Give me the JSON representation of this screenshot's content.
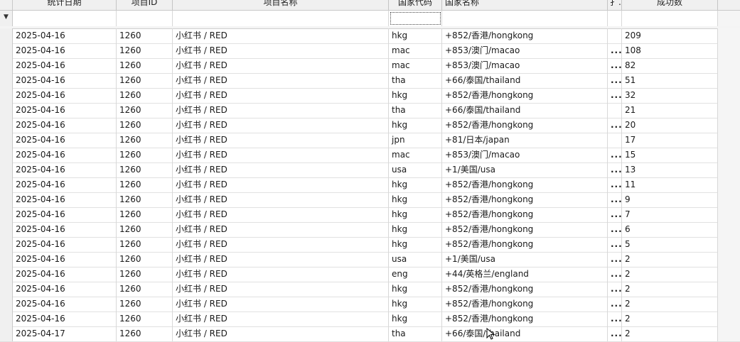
{
  "grid": {
    "columns": [
      "统计日期",
      "项目ID",
      "项目名称",
      "国家代码",
      "国家名称",
      "扌..",
      "成功数"
    ],
    "filter_indicator": "▼",
    "rows": [
      {
        "date": "2025-04-16",
        "id": "1260",
        "name": "小红书 / RED",
        "code": "hkg",
        "country": "+852/香港/hongkong",
        "ex": "",
        "count": "209"
      },
      {
        "date": "2025-04-16",
        "id": "1260",
        "name": "小红书 / RED",
        "code": "mac",
        "country": "+853/澳门/macao",
        "ex": "...",
        "count": "108"
      },
      {
        "date": "2025-04-16",
        "id": "1260",
        "name": "小红书 / RED",
        "code": "mac",
        "country": "+853/澳门/macao",
        "ex": "...",
        "count": "82"
      },
      {
        "date": "2025-04-16",
        "id": "1260",
        "name": "小红书 / RED",
        "code": "tha",
        "country": "+66/泰国/thailand",
        "ex": "...",
        "count": "51"
      },
      {
        "date": "2025-04-16",
        "id": "1260",
        "name": "小红书 / RED",
        "code": "hkg",
        "country": "+852/香港/hongkong",
        "ex": "...",
        "count": "32"
      },
      {
        "date": "2025-04-16",
        "id": "1260",
        "name": "小红书 / RED",
        "code": "tha",
        "country": "+66/泰国/thailand",
        "ex": "",
        "count": "21"
      },
      {
        "date": "2025-04-16",
        "id": "1260",
        "name": "小红书 / RED",
        "code": "hkg",
        "country": "+852/香港/hongkong",
        "ex": "...",
        "count": "20"
      },
      {
        "date": "2025-04-16",
        "id": "1260",
        "name": "小红书 / RED",
        "code": "jpn",
        "country": "+81/日本/japan",
        "ex": "",
        "count": "17"
      },
      {
        "date": "2025-04-16",
        "id": "1260",
        "name": "小红书 / RED",
        "code": "mac",
        "country": "+853/澳门/macao",
        "ex": "...",
        "count": "15"
      },
      {
        "date": "2025-04-16",
        "id": "1260",
        "name": "小红书 / RED",
        "code": "usa",
        "country": "+1/美国/usa",
        "ex": "...",
        "count": "13"
      },
      {
        "date": "2025-04-16",
        "id": "1260",
        "name": "小红书 / RED",
        "code": "hkg",
        "country": "+852/香港/hongkong",
        "ex": "...",
        "count": "11"
      },
      {
        "date": "2025-04-16",
        "id": "1260",
        "name": "小红书 / RED",
        "code": "hkg",
        "country": "+852/香港/hongkong",
        "ex": "...",
        "count": "9"
      },
      {
        "date": "2025-04-16",
        "id": "1260",
        "name": "小红书 / RED",
        "code": "hkg",
        "country": "+852/香港/hongkong",
        "ex": "...",
        "count": "7"
      },
      {
        "date": "2025-04-16",
        "id": "1260",
        "name": "小红书 / RED",
        "code": "hkg",
        "country": "+852/香港/hongkong",
        "ex": "...",
        "count": "6"
      },
      {
        "date": "2025-04-16",
        "id": "1260",
        "name": "小红书 / RED",
        "code": "hkg",
        "country": "+852/香港/hongkong",
        "ex": "...",
        "count": "5"
      },
      {
        "date": "2025-04-16",
        "id": "1260",
        "name": "小红书 / RED",
        "code": "usa",
        "country": "+1/美国/usa",
        "ex": "...",
        "count": "2"
      },
      {
        "date": "2025-04-16",
        "id": "1260",
        "name": "小红书 / RED",
        "code": "eng",
        "country": "+44/英格兰/england",
        "ex": "...",
        "count": "2"
      },
      {
        "date": "2025-04-16",
        "id": "1260",
        "name": "小红书 / RED",
        "code": "hkg",
        "country": "+852/香港/hongkong",
        "ex": "...",
        "count": "2"
      },
      {
        "date": "2025-04-16",
        "id": "1260",
        "name": "小红书 / RED",
        "code": "hkg",
        "country": "+852/香港/hongkong",
        "ex": "...",
        "count": "2"
      },
      {
        "date": "2025-04-16",
        "id": "1260",
        "name": "小红书 / RED",
        "code": "hkg",
        "country": "+852/香港/hongkong",
        "ex": "...",
        "count": "2"
      },
      {
        "date": "2025-04-17",
        "id": "1260",
        "name": "小红书 / RED",
        "code": "tha",
        "country": "+66/泰国/thailand",
        "ex": "...",
        "count": "2"
      }
    ]
  }
}
